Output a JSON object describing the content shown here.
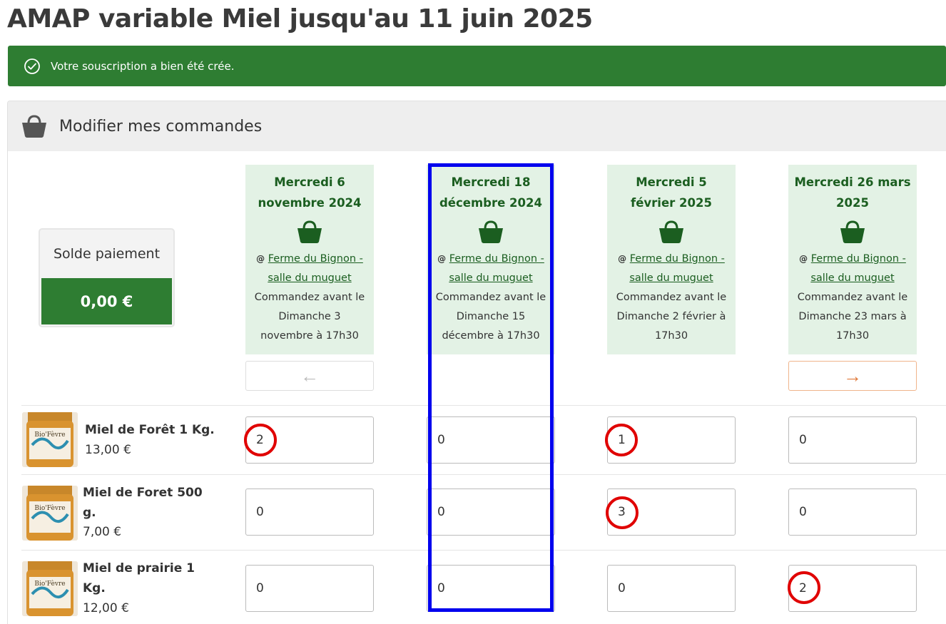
{
  "page": {
    "title": "AMAP variable Miel jusqu'au 11 juin 2025"
  },
  "alert": {
    "icon": "check-circle-icon",
    "message": "Votre souscription a bien été crée.",
    "color": "#2e7d32"
  },
  "panel": {
    "icon": "basket-icon",
    "title": "Modifier mes commandes"
  },
  "balance": {
    "label": "Solde paiement",
    "value": "0,00 €"
  },
  "dates": [
    {
      "date": "Mercredi 6 novembre 2024",
      "at": "@",
      "location": "Ferme du Bignon - salle du muguet",
      "deadline": "Commandez avant le Dimanche 3 novembre à 17h30"
    },
    {
      "date": "Mercredi 18 décembre 2024",
      "at": "@",
      "location": "Ferme du Bignon - salle du muguet",
      "deadline": "Commandez avant le Dimanche 15 décembre à 17h30"
    },
    {
      "date": "Mercredi 5 février 2025",
      "at": "@",
      "location": "Ferme du Bignon - salle du muguet",
      "deadline": "Commandez avant le Dimanche 2 février à 17h30"
    },
    {
      "date": "Mercredi 26 mars 2025",
      "at": "@",
      "location": "Ferme du Bignon - salle du muguet",
      "deadline": "Commandez avant le Dimanche 23 mars à 17h30"
    }
  ],
  "nav": {
    "prev_icon": "←",
    "next_icon": "→"
  },
  "products": [
    {
      "name": "Miel de Forêt 1 Kg.",
      "price": "13,00 €",
      "quantities": [
        "2",
        "0",
        "1",
        "0"
      ]
    },
    {
      "name": "Miel de Foret 500 g.",
      "price": "7,00 €",
      "quantities": [
        "0",
        "0",
        "3",
        "0"
      ]
    },
    {
      "name": "Miel de prairie 1 Kg.",
      "price": "12,00 €",
      "quantities": [
        "0",
        "0",
        "0",
        "2"
      ]
    }
  ],
  "colors": {
    "brand_green": "#2e7d32",
    "card_green": "#e3f2e5",
    "highlight_blue": "#0000ee",
    "annotation_red": "#e00000",
    "next_orange": "#e07a3b"
  }
}
